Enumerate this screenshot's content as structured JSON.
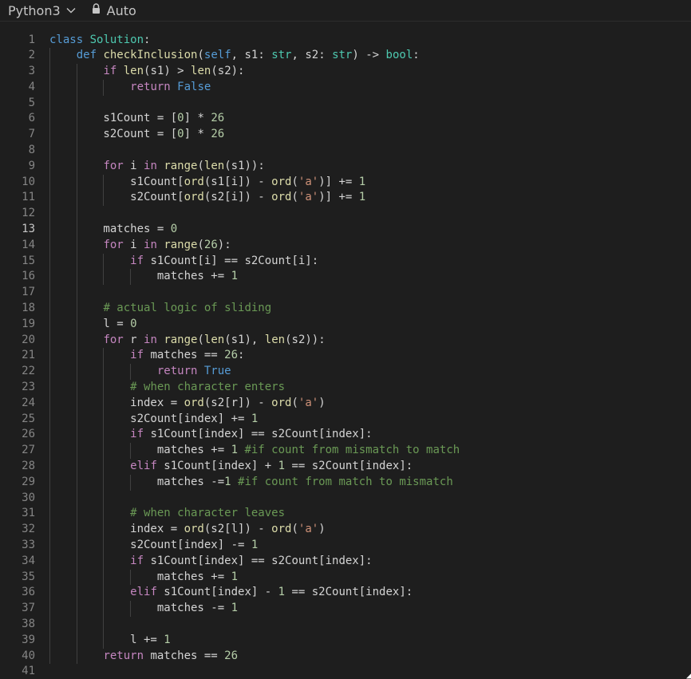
{
  "toolbar": {
    "language": "Python3",
    "mode": "Auto"
  },
  "active_line": 13,
  "code_lines": [
    "class Solution:",
    "    def checkInclusion(self, s1: str, s2: str) -> bool:",
    "        if len(s1) > len(s2):",
    "            return False",
    "",
    "        s1Count = [0] * 26",
    "        s2Count = [0] * 26",
    "",
    "        for i in range(len(s1)):",
    "            s1Count[ord(s1[i]) - ord('a')] += 1",
    "            s2Count[ord(s2[i]) - ord('a')] += 1",
    "",
    "        matches = 0",
    "        for i in range(26):",
    "            if s1Count[i] == s2Count[i]:",
    "                matches += 1",
    "",
    "        # actual logic of sliding",
    "        l = 0",
    "        for r in range(len(s1), len(s2)):",
    "            if matches == 26:",
    "                return True",
    "            # when character enters",
    "            index = ord(s2[r]) - ord('a')",
    "            s2Count[index] += 1",
    "            if s1Count[index] == s2Count[index]:",
    "                matches += 1 #if count from mismatch to match",
    "            elif s1Count[index] + 1 == s2Count[index]:",
    "                matches -=1 #if count from match to mismatch",
    "",
    "            # when character leaves",
    "            index = ord(s2[l]) - ord('a')",
    "            s2Count[index] -= 1",
    "            if s1Count[index] == s2Count[index]:",
    "                matches += 1",
    "            elif s1Count[index] - 1 == s2Count[index]:",
    "                matches -= 1",
    "",
    "            l += 1",
    "        return matches == 26",
    ""
  ]
}
